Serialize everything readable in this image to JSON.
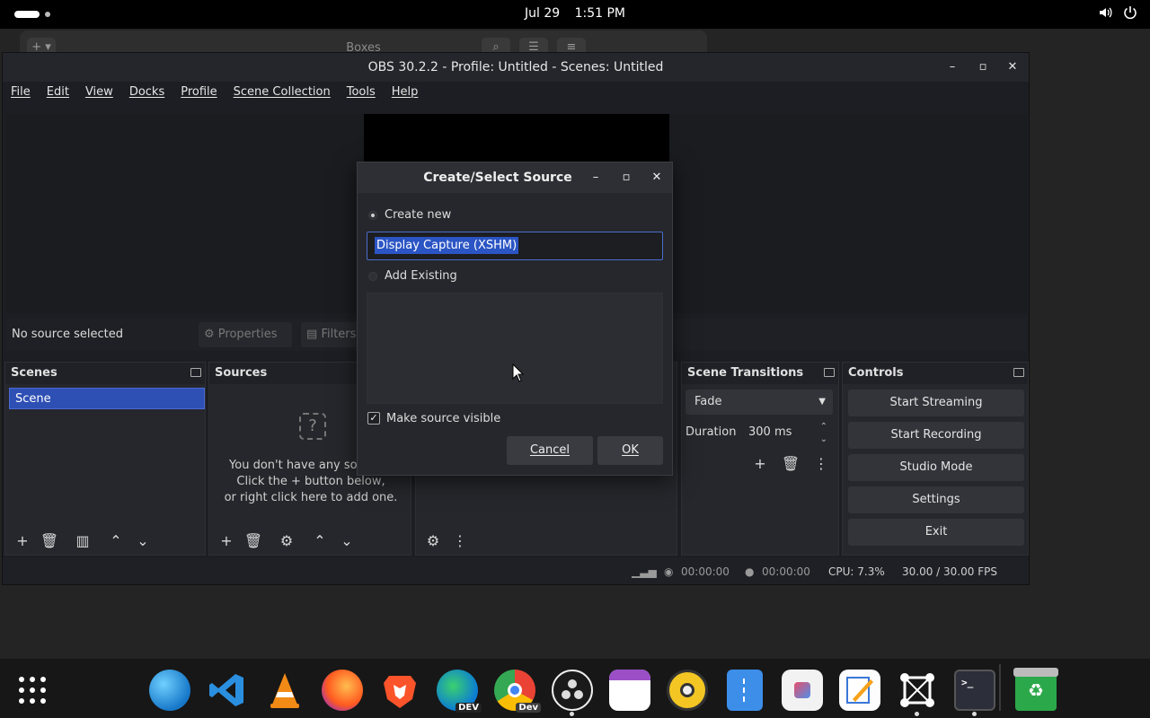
{
  "topbar": {
    "date": "Jul 29",
    "time": "1:51 PM",
    "volume_icon": "speaker-icon",
    "power_icon": "power-icon"
  },
  "boxes_window": {
    "title": "Boxes"
  },
  "obs": {
    "title": "OBS 30.2.2 - Profile: Untitled - Scenes: Untitled",
    "menu": [
      "File",
      "Edit",
      "View",
      "Docks",
      "Profile",
      "Scene Collection",
      "Tools",
      "Help"
    ],
    "source_bar": {
      "no_source": "No source selected",
      "properties": "Properties",
      "filters": "Filters"
    },
    "scenes": {
      "title": "Scenes",
      "items": [
        "Scene"
      ]
    },
    "sources": {
      "title": "Sources",
      "empty_line1": "You don't have any sources.",
      "empty_line2": "Click the + button below,",
      "empty_line3": "or right click here to add one."
    },
    "transitions": {
      "title": "Scene Transitions",
      "selected": "Fade",
      "duration_label": "Duration",
      "duration_value": "300 ms"
    },
    "controls": {
      "title": "Controls",
      "buttons": [
        "Start Streaming",
        "Start Recording",
        "Studio Mode",
        "Settings",
        "Exit"
      ]
    },
    "status": {
      "stream_time": "00:00:00",
      "record_time": "00:00:00",
      "cpu": "CPU: 7.3%",
      "fps": "30.00 / 30.00 FPS"
    }
  },
  "dialog": {
    "title": "Create/Select Source",
    "create_new": "Create new",
    "name_value": "Display Capture (XSHM)",
    "add_existing": "Add Existing",
    "make_visible": "Make source visible",
    "cancel": "Cancel",
    "ok": "OK"
  },
  "dock_apps": [
    {
      "name": "app-grid-icon"
    },
    {
      "name": "globe-icon"
    },
    {
      "name": "vscode-icon"
    },
    {
      "name": "vlc-icon"
    },
    {
      "name": "firefox-icon"
    },
    {
      "name": "brave-icon"
    },
    {
      "name": "edge-dev-icon",
      "badge": "DEV"
    },
    {
      "name": "chrome-dev-icon",
      "badge": "Dev"
    },
    {
      "name": "obs-icon"
    },
    {
      "name": "calendar-icon"
    },
    {
      "name": "rhythmbox-icon"
    },
    {
      "name": "archive-icon"
    },
    {
      "name": "software-store-icon"
    },
    {
      "name": "text-editor-icon"
    },
    {
      "name": "boxes-icon"
    },
    {
      "name": "terminal-icon",
      "label": ">_"
    },
    {
      "name": "trash-icon"
    }
  ]
}
